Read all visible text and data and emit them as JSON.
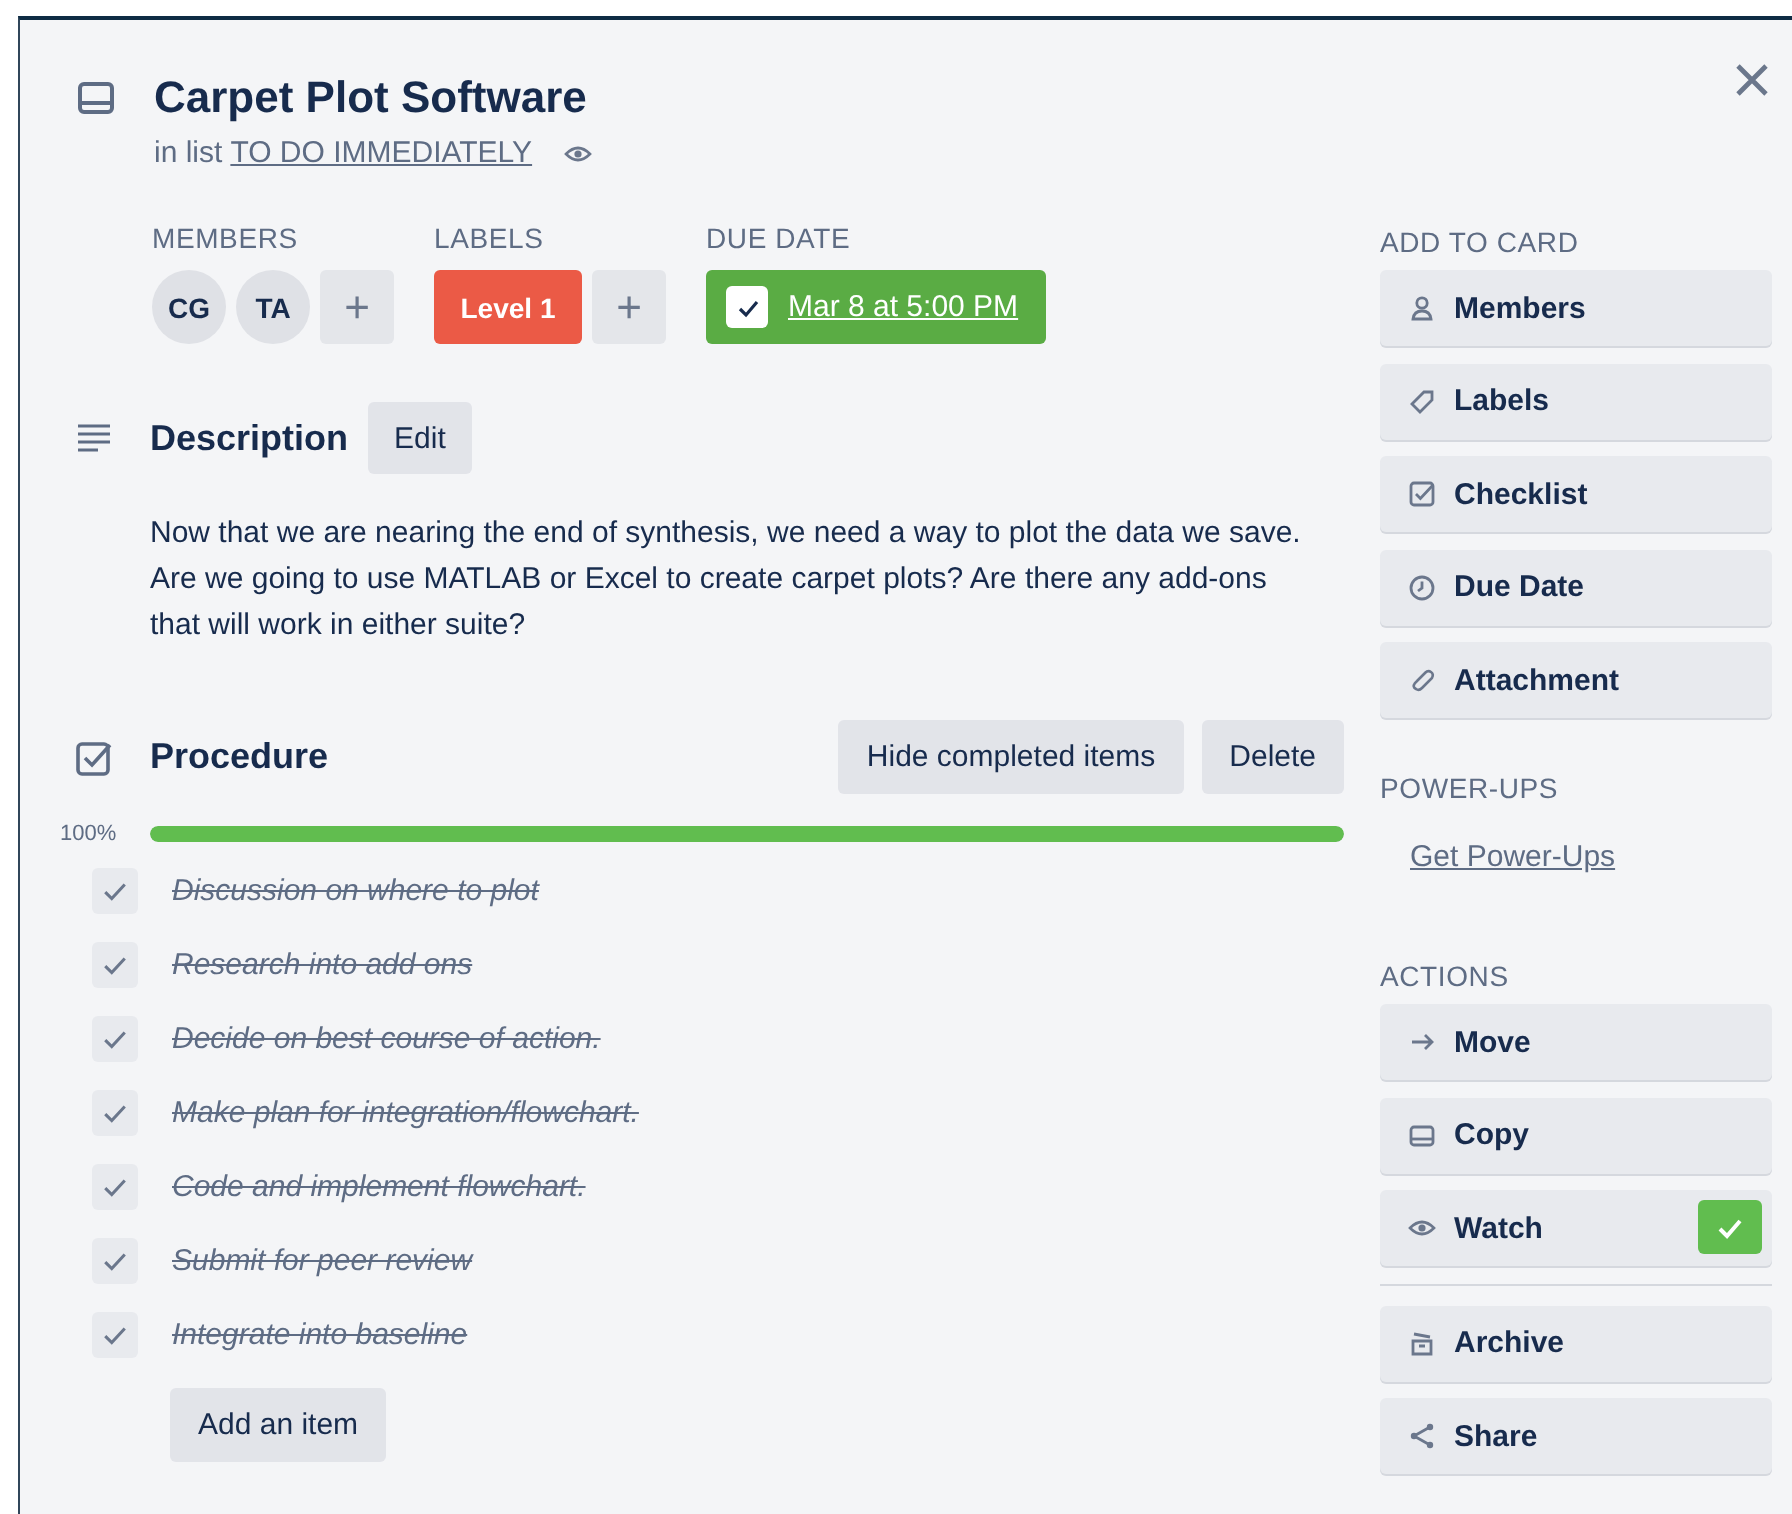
{
  "card": {
    "title": "Carpet Plot Software",
    "list_prefix": "in list",
    "list_name": "TO DO IMMEDIATELY"
  },
  "meta": {
    "members_heading": "MEMBERS",
    "members": [
      {
        "initials": "CG"
      },
      {
        "initials": "TA"
      }
    ],
    "labels_heading": "LABELS",
    "labels": [
      {
        "text": "Level 1",
        "color": "#eb5a46"
      }
    ],
    "due_heading": "DUE DATE",
    "due": {
      "text": "Mar 8 at 5:00 PM",
      "complete": true
    },
    "add_symbol": "+"
  },
  "description": {
    "heading": "Description",
    "edit": "Edit",
    "text": "Now that we are nearing the end of synthesis, we need a way to plot the data we save. Are we going to use MATLAB or Excel to create carpet plots? Are there any add-ons that will work in either suite?"
  },
  "checklist": {
    "title": "Procedure",
    "hide_button": "Hide completed items",
    "delete_button": "Delete",
    "percent": "100%",
    "level": 1,
    "items": [
      {
        "text": "Discussion on where to plot",
        "checked": true
      },
      {
        "text": "Research into add ons",
        "checked": true
      },
      {
        "text": "Decide on best course of action.",
        "checked": true
      },
      {
        "text": "Make plan for integration/flowchart.",
        "checked": true
      },
      {
        "text": "Code and implement flowchart.",
        "checked": true
      },
      {
        "text": "Submit for peer review",
        "checked": true
      },
      {
        "text": "Integrate into baseline",
        "checked": true
      }
    ],
    "add_button": "Add an item"
  },
  "sidebar": {
    "add_heading": "ADD TO CARD",
    "add_buttons": [
      {
        "label": "Members"
      },
      {
        "label": "Labels"
      },
      {
        "label": "Checklist"
      },
      {
        "label": "Due Date"
      },
      {
        "label": "Attachment"
      }
    ],
    "powerups_heading": "POWER-UPS",
    "powerups_link": "Get Power-Ups",
    "actions_heading": "ACTIONS",
    "actions": [
      {
        "label": "Move"
      },
      {
        "label": "Copy"
      },
      {
        "label": "Watch",
        "on": true
      },
      {
        "label": "Archive"
      },
      {
        "label": "Share"
      }
    ]
  }
}
